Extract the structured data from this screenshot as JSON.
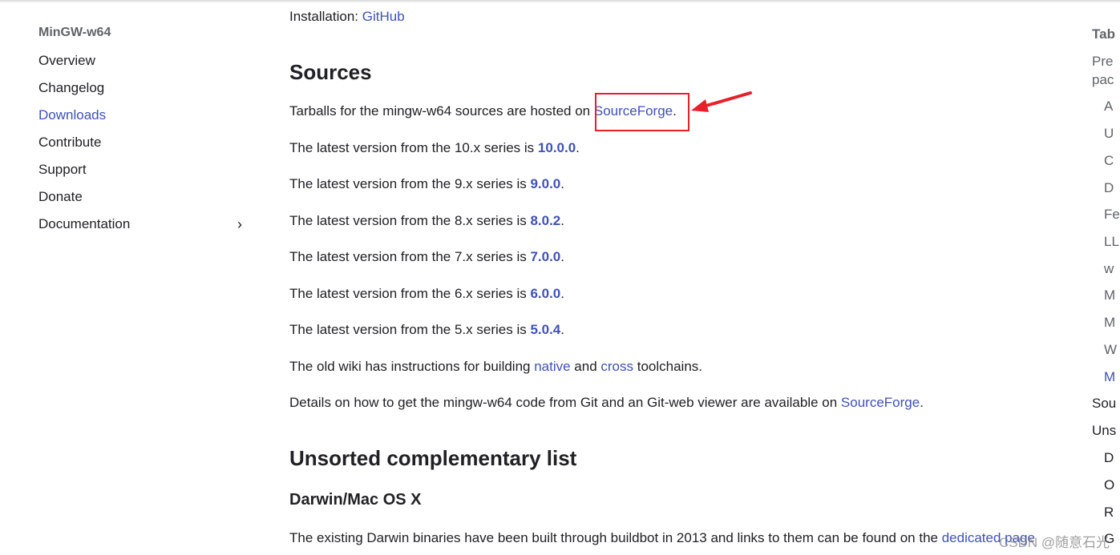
{
  "sidebar": {
    "title": "MinGW-w64",
    "items": [
      {
        "label": "Overview"
      },
      {
        "label": "Changelog"
      },
      {
        "label": "Downloads",
        "active": true
      },
      {
        "label": "Contribute"
      },
      {
        "label": "Support"
      },
      {
        "label": "Donate"
      },
      {
        "label": "Documentation"
      }
    ]
  },
  "main": {
    "installation_label": "Installation: ",
    "installation_link": "GitHub",
    "sources_heading": "Sources",
    "tarballs_text": "Tarballs for the mingw-w64 sources are hosted on ",
    "tarballs_link": "SourceForge",
    "versions": [
      {
        "text": "The latest version from the 10.x series is ",
        "version": "10.0.0"
      },
      {
        "text": "The latest version from the 9.x series is ",
        "version": "9.0.0"
      },
      {
        "text": "The latest version from the 8.x series is ",
        "version": "8.0.2"
      },
      {
        "text": "The latest version from the 7.x series is ",
        "version": "7.0.0"
      },
      {
        "text": "The latest version from the 6.x series is ",
        "version": "6.0.0"
      },
      {
        "text": "The latest version from the 5.x series is ",
        "version": "5.0.4"
      }
    ],
    "wiki_pre": "The old wiki has instructions for building ",
    "wiki_native": "native",
    "wiki_and": " and ",
    "wiki_cross": "cross",
    "wiki_post": " toolchains.",
    "git_text": "Details on how to get the mingw-w64 code from Git and an Git-web viewer are available on ",
    "git_link": "SourceForge",
    "unsorted_heading": "Unsorted complementary list",
    "darwin_heading": "Darwin/Mac OS X",
    "darwin_text": "The existing Darwin binaries have been built through buildbot in 2013 and links to them can be found on the ",
    "darwin_link": "dedicated page"
  },
  "toc": {
    "items": [
      "Tab",
      "Pre",
      "pac",
      "A",
      "U",
      "C",
      "D",
      "Fe",
      "LL",
      "w",
      "M",
      "M",
      "W",
      "M",
      "Sou",
      "Uns",
      "D",
      "O",
      "R",
      "G"
    ]
  },
  "annotation_color": "#e8202a",
  "link_color": "#3f51b5",
  "watermark": "CSDN @随意石光"
}
